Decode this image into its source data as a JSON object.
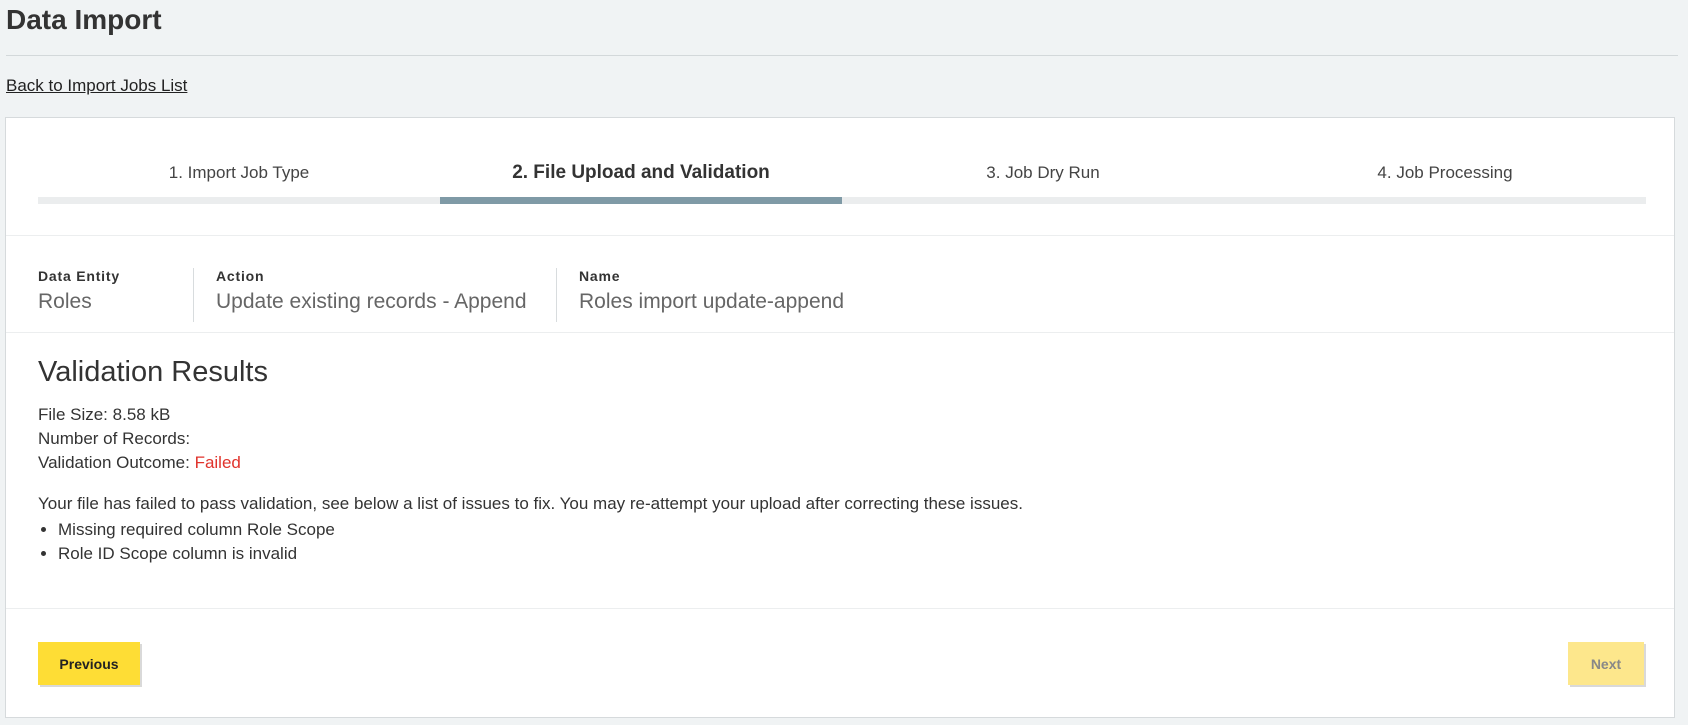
{
  "page": {
    "title": "Data Import",
    "back_link": "Back to Import Jobs List"
  },
  "steps": [
    {
      "label": "1. Import Job Type",
      "active": false
    },
    {
      "label": "2. File Upload and Validation",
      "active": true
    },
    {
      "label": "3. Job Dry Run",
      "active": false
    },
    {
      "label": "4. Job Processing",
      "active": false
    }
  ],
  "meta": {
    "entity_label": "Data Entity",
    "entity_value": "Roles",
    "action_label": "Action",
    "action_value": "Update existing records - Append",
    "name_label": "Name",
    "name_value": "Roles import update-append"
  },
  "validation": {
    "title": "Validation Results",
    "file_size_label": "File Size:",
    "file_size_value": "8.58 kB",
    "records_label": "Number of Records:",
    "records_value": "",
    "outcome_label": "Validation Outcome:",
    "outcome_value": "Failed",
    "outcome_color": "#e0332c",
    "message": "Your file has failed to pass validation, see below a list of issues to fix. You may re-attempt your upload after correcting these issues.",
    "issues": [
      "Missing required column Role Scope",
      "Role ID Scope column is invalid"
    ]
  },
  "buttons": {
    "previous": "Previous",
    "next": "Next"
  },
  "colors": {
    "accent_yellow": "#fedd35",
    "active_step_bar": "#7f9aa6",
    "disabled_yellow": "#fde78c"
  }
}
